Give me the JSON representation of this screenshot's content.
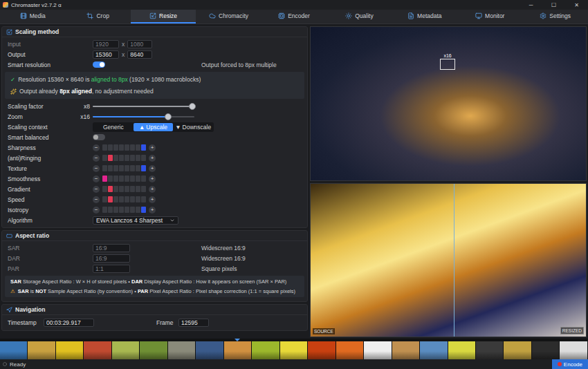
{
  "window": {
    "title": "Chromaster v2.7.2 α",
    "controls": [
      "─",
      "☐",
      "✕"
    ]
  },
  "tabs": [
    {
      "label": "Media",
      "selected": false
    },
    {
      "label": "Crop",
      "selected": false
    },
    {
      "label": "Resize",
      "selected": true
    },
    {
      "label": "Chromacity",
      "selected": false
    },
    {
      "label": "Encoder",
      "selected": false
    },
    {
      "label": "Quality",
      "selected": false
    },
    {
      "label": "Metadata",
      "selected": false
    },
    {
      "label": "Monitor",
      "selected": false
    },
    {
      "label": "Settings",
      "selected": false
    }
  ],
  "scaling_method": {
    "title": "Scaling method",
    "dimensions": [
      {
        "label": "Input",
        "width": "1920",
        "separator": "x",
        "height": "1080",
        "disabled": true
      },
      {
        "label": "Output",
        "width": "15360",
        "separator": "x",
        "height": "8640",
        "disabled": false
      }
    ],
    "smart_resolution": {
      "label": "Smart resolution",
      "on": true,
      "note": "Output forced to 8px multiple"
    },
    "notices": [
      {
        "icon": "✓",
        "parts": [
          {
            "text": "Resolution 15360 × 8640 is ",
            "style": "plain"
          },
          {
            "text": "aligned to 8px",
            "style": "good"
          },
          {
            "text": " (1920 × 1080 macroblocks)",
            "style": "plain"
          }
        ]
      },
      {
        "parts": [
          {
            "text": "Output already ",
            "style": "plain"
          },
          {
            "text": "8px aligned",
            "style": "strong"
          },
          {
            "text": ", no adjustment needed",
            "style": "plain"
          }
        ]
      }
    ],
    "sliders": [
      {
        "label": "Scaling factor",
        "value": "x8",
        "level": 0.98,
        "color": "#9a9ca2"
      },
      {
        "label": "Zoom",
        "value": "x16",
        "level": 0.74,
        "color": "#3d8bfd"
      }
    ],
    "scaling_context": {
      "label": "Scaling context",
      "options": [
        {
          "label": "Generic",
          "selected": false
        },
        {
          "label": "Upscale",
          "icon": "▲",
          "selected": true
        },
        {
          "label": "Downscale",
          "icon": "▼",
          "selected": false
        }
      ]
    },
    "smart_balanced": {
      "label": "Smart balanced",
      "on": false
    },
    "step_buttons": {
      "minus": "−",
      "plus": "+"
    },
    "meters": [
      {
        "label": "Sharpness",
        "level": 1.0,
        "color": "#2f52e8"
      },
      {
        "label": "(anti)Ringing",
        "level": 0.25,
        "color": "#e23a55"
      },
      {
        "label": "Texture",
        "level": 1.0,
        "color": "#2f52e8"
      },
      {
        "label": "Smoothness",
        "level": 0.125,
        "color": "#e2248f"
      },
      {
        "label": "Gradient",
        "level": 0.25,
        "color": "#e23a55"
      },
      {
        "label": "Speed",
        "level": 0.25,
        "color": "#e23a55"
      },
      {
        "label": "Isotropy",
        "level": 1.0,
        "color": "#2f52e8"
      }
    ],
    "algorithm": {
      "label": "Algorithm",
      "value": "EWA Lanczos 4 Sharpest"
    }
  },
  "aspect_ratio": {
    "title": "Aspect ratio",
    "rows": [
      {
        "label": "SAR",
        "value": "16:9",
        "description": "Widescreen 16:9",
        "disabled": true
      },
      {
        "label": "DAR",
        "value": "16:9",
        "description": "Widescreen 16:9",
        "disabled": true
      },
      {
        "label": "PAR",
        "value": "1:1",
        "description": "Square pixels",
        "disabled": true
      }
    ],
    "notes": [
      {
        "parts": [
          {
            "text": "SAR",
            "style": "strong"
          },
          {
            "text": " Storage Aspect Ratio : W × H of stored pixels • ",
            "style": "plain"
          },
          {
            "text": "DAR",
            "style": "strong"
          },
          {
            "text": " Display Aspect Ratio : How it appears on screen (SAR × PAR)",
            "style": "plain"
          }
        ]
      },
      {
        "icon": "⚠",
        "parts": [
          {
            "text": "SAR",
            "style": "strong"
          },
          {
            "text": " is ",
            "style": "plain"
          },
          {
            "text": "NOT",
            "style": "strong"
          },
          {
            "text": " Sample Aspect Ratio (by convention) • ",
            "style": "plain"
          },
          {
            "text": "PAR",
            "style": "strong"
          },
          {
            "text": " Pixel Aspect Ratio : Pixel shape correction (1:1 = square pixels)",
            "style": "plain"
          }
        ]
      }
    ]
  },
  "navigation": {
    "title": "Navigation",
    "timestamp": {
      "label": "Timestamp",
      "value": "00:03:29.917"
    },
    "frame": {
      "label": "Frame",
      "value": "12595"
    }
  },
  "preview": {
    "top": {
      "badge": "x16"
    },
    "bottom": {
      "left_label": "SOURCE",
      "right_label": "RESIZED"
    }
  },
  "filmstrip": [
    {
      "color": "#3a78b8",
      "selected": false
    },
    {
      "color": "#c8a040",
      "selected": false
    },
    {
      "color": "#e0c020",
      "selected": false
    },
    {
      "color": "#c04a30",
      "selected": false
    },
    {
      "color": "#a8b850",
      "selected": false
    },
    {
      "color": "#6f8f34",
      "selected": false
    },
    {
      "color": "#8a8a7a",
      "selected": false
    },
    {
      "color": "#3a5a8a",
      "selected": false
    },
    {
      "color": "#d09040",
      "selected": true
    },
    {
      "color": "#9cb82c",
      "selected": false
    },
    {
      "color": "#e8d838",
      "selected": false
    },
    {
      "color": "#c84010",
      "selected": false
    },
    {
      "color": "#e06a20",
      "selected": false
    },
    {
      "color": "#eeeeee",
      "selected": false
    },
    {
      "color": "#c09050",
      "selected": false
    },
    {
      "color": "#5a8cc0",
      "selected": false
    },
    {
      "color": "#d8d840",
      "selected": false
    },
    {
      "color": "#3a3a3a",
      "selected": false
    },
    {
      "color": "#c0a040",
      "selected": false
    },
    {
      "color": "#2c2c2c",
      "selected": false
    },
    {
      "color": "#dcdcdc",
      "selected": false
    }
  ],
  "status_bar": {
    "text": "Ready",
    "button": "Encode"
  }
}
